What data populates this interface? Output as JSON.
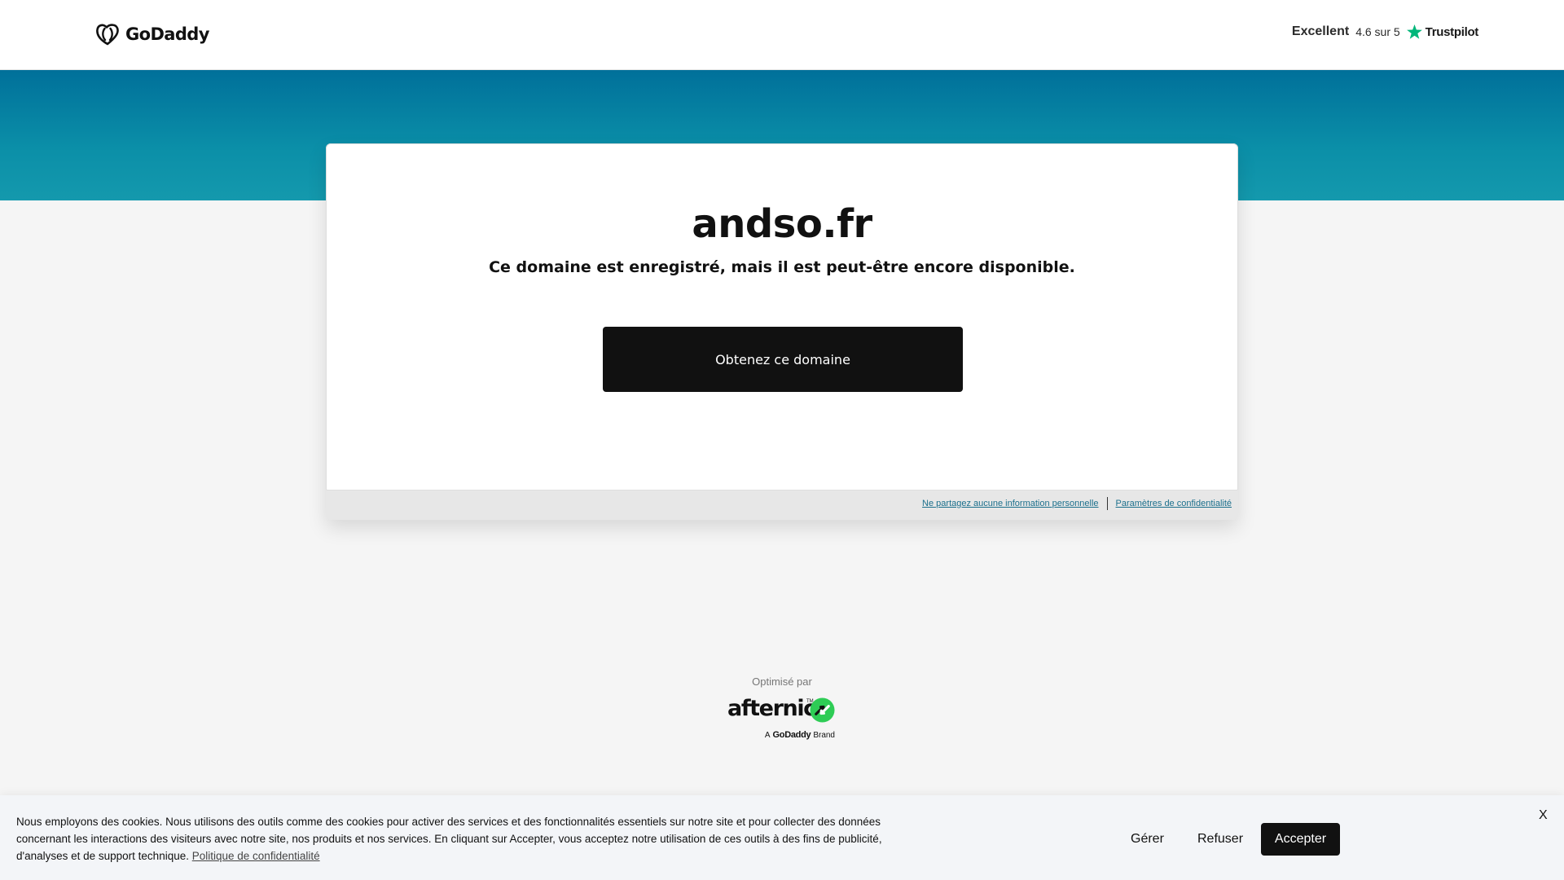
{
  "header": {
    "brand": "GoDaddy",
    "rating_label": "Excellent",
    "rating_score": "4.6 sur 5",
    "review_site": "Trustpilot"
  },
  "colors": {
    "hero_top": "#00709a",
    "hero_bottom": "#1499ad",
    "trustpilot_star": "#00b67a",
    "afternic_green": "#2ecc55",
    "button_dark": "#111111",
    "link": "#1b6f8c"
  },
  "icons": {
    "logo": "godaddy-heart-icon",
    "rating": "star-icon",
    "afternic": "afternic-arrows-icon"
  },
  "card": {
    "domain": "andso.fr",
    "subtitle": "Ce domaine est enregistré, mais il est peut-être encore disponible.",
    "cta_label": "Obtenez ce domaine",
    "privacy_link_1": "Ne partagez aucune information personnelle",
    "privacy_link_2": "Paramètres de confidentialité"
  },
  "footer": {
    "powered_by": "Optimisé par",
    "partner": "afternic",
    "trademark": "TM",
    "partner_sub_prefix": "A",
    "partner_sub_brand": "GoDaddy",
    "partner_sub_suffix": "Brand"
  },
  "cookie_banner": {
    "text": "Nous employons des cookies. Nous utilisons des outils comme des cookies pour activer des services et des fonctionnalités essentiels sur notre site et pour collecter des données concernant les interactions des visiteurs avec notre site, nos produits et nos services. En cliquant sur Accepter, vous acceptez notre utilisation de ces outils à des fins de publicité, d'analyses et de support technique.",
    "policy_link": "Politique de confidentialité",
    "manage_label": "Gérer",
    "refuse_label": "Refuser",
    "accept_label": "Accepter",
    "close_label": "X"
  }
}
